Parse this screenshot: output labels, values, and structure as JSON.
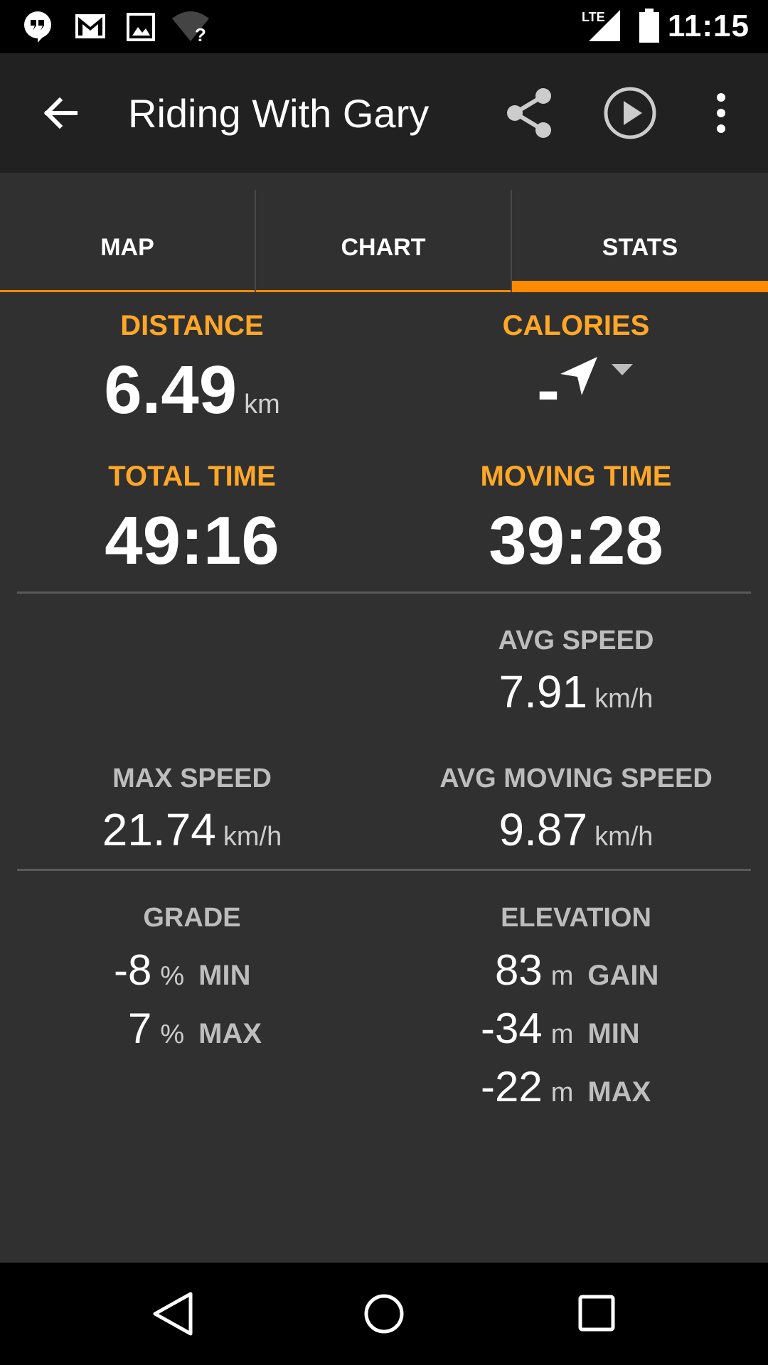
{
  "status_bar": {
    "icons": [
      "hangouts-icon",
      "gmail-icon",
      "gallery-icon",
      "wifi-question-icon",
      "lte-icon",
      "signal-icon",
      "battery-icon"
    ],
    "lte": "LTE",
    "time": "11:15"
  },
  "app_bar": {
    "title": "Riding With Gary",
    "icons": [
      "back-arrow-icon",
      "share-icon",
      "play-icon",
      "more-vert-icon"
    ]
  },
  "tabs": [
    {
      "label": "MAP",
      "active": false
    },
    {
      "label": "CHART",
      "active": false
    },
    {
      "label": "STATS",
      "active": true
    }
  ],
  "stats": {
    "distance": {
      "label": "DISTANCE",
      "value": "6.49",
      "unit": "km"
    },
    "calories": {
      "label": "CALORIES",
      "value": "-"
    },
    "total_time": {
      "label": "TOTAL TIME",
      "value": "49:16"
    },
    "moving_time": {
      "label": "MOVING TIME",
      "value": "39:28"
    },
    "avg_speed": {
      "label": "AVG SPEED",
      "value": "7.91",
      "unit": "km/h"
    },
    "max_speed": {
      "label": "MAX SPEED",
      "value": "21.74",
      "unit": "km/h"
    },
    "avg_moving_speed": {
      "label": "AVG MOVING SPEED",
      "value": "9.87",
      "unit": "km/h"
    },
    "grade": {
      "label": "GRADE",
      "rows": [
        {
          "value": "-8",
          "unit": "%",
          "qualifier": "MIN"
        },
        {
          "value": "7",
          "unit": "%",
          "qualifier": "MAX"
        }
      ]
    },
    "elevation": {
      "label": "ELEVATION",
      "rows": [
        {
          "value": "83",
          "unit": "m",
          "qualifier": "GAIN"
        },
        {
          "value": "-34",
          "unit": "m",
          "qualifier": "MIN"
        },
        {
          "value": "-22",
          "unit": "m",
          "qualifier": "MAX"
        }
      ]
    }
  },
  "colors": {
    "accent": "#ff8a00",
    "label_orange": "#ffa726",
    "background": "#303030",
    "appbar": "#212121"
  },
  "nav_bar": {
    "icons": [
      "back-triangle-icon",
      "home-circle-icon",
      "recents-square-icon"
    ]
  }
}
